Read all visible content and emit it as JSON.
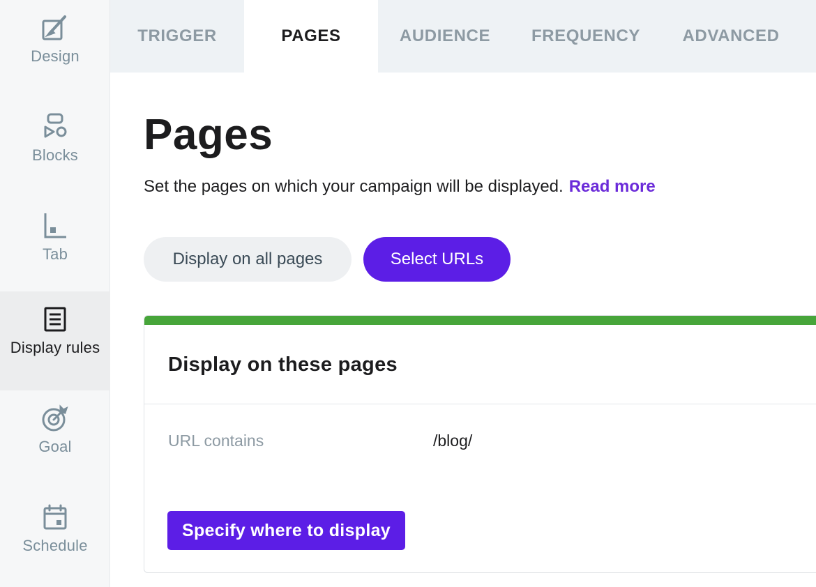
{
  "sidebar": {
    "items": [
      {
        "label": "Design",
        "icon": "paint-brush-icon",
        "active": false
      },
      {
        "label": "Blocks",
        "icon": "blocks-icon",
        "active": false
      },
      {
        "label": "Tab",
        "icon": "tab-icon",
        "active": false
      },
      {
        "label": "Display rules",
        "icon": "document-list-icon",
        "active": true
      },
      {
        "label": "Goal",
        "icon": "target-icon",
        "active": false
      },
      {
        "label": "Schedule",
        "icon": "calendar-icon",
        "active": false
      }
    ]
  },
  "tabs": [
    {
      "label": "TRIGGER",
      "active": false
    },
    {
      "label": "PAGES",
      "active": true
    },
    {
      "label": "AUDIENCE",
      "active": false
    },
    {
      "label": "FREQUENCY",
      "active": false
    },
    {
      "label": "ADVANCED",
      "active": false
    }
  ],
  "main": {
    "title": "Pages",
    "subtitle": "Set the pages on which your campaign will be displayed.",
    "read_more": "Read more",
    "options": {
      "all_pages": "Display on all pages",
      "select_urls": "Select URLs",
      "selected": "select_urls"
    },
    "card": {
      "title": "Display on these pages",
      "rule_label": "URL contains",
      "rule_value": "/blog/",
      "button": "Specify where to display"
    }
  },
  "colors": {
    "accent": "#5c1ee6",
    "link": "#6b2bd9",
    "success_bar": "#47a53a",
    "muted": "#7a8e9a",
    "tab_bg": "#eef2f5",
    "sidebar_bg": "#f6f7f8"
  }
}
